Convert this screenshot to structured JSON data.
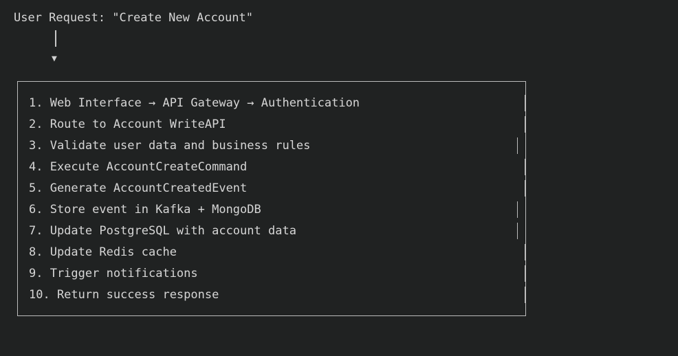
{
  "header": {
    "request_line": "User Request: \"Create New Account\""
  },
  "arrow": {
    "stem_char": "|",
    "head_char": "▼"
  },
  "steps": [
    {
      "label": "1. Web Interface → API Gateway → Authentication"
    },
    {
      "label": "2. Route to Account WriteAPI"
    },
    {
      "label": "3. Validate user data and business rules"
    },
    {
      "label": "4. Execute AccountCreateCommand"
    },
    {
      "label": "5. Generate AccountCreatedEvent"
    },
    {
      "label": "6. Store event in Kafka + MongoDB"
    },
    {
      "label": "7. Update PostgreSQL with account data"
    },
    {
      "label": "8. Update Redis cache"
    },
    {
      "label": "9. Trigger notifications"
    },
    {
      "label": "10. Return success response"
    }
  ],
  "colors": {
    "background": "#202222",
    "text": "#d6d6d6",
    "border": "#bdbdbd"
  }
}
